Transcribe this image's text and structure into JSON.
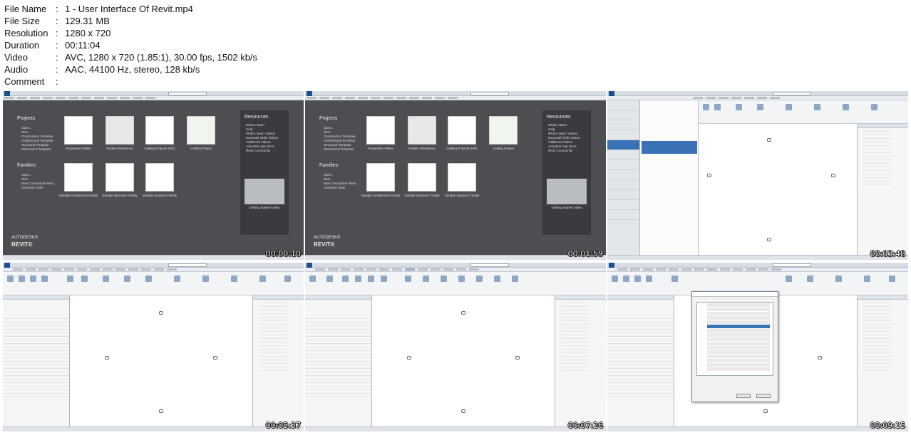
{
  "meta": [
    {
      "key": "File Name",
      "value": "1 - User Interface Of Revit.mp4"
    },
    {
      "key": "File Size",
      "value": "129.31 MB"
    },
    {
      "key": "Resolution",
      "value": "1280 x 720"
    },
    {
      "key": "Duration",
      "value": "00:11:04"
    },
    {
      "key": "Video",
      "value": "AVC, 1280 x 720 (1.85:1), 30.00 fps, 1502 kb/s"
    },
    {
      "key": "Audio",
      "value": "AAC, 44100 Hz, stereo, 128 kb/s"
    },
    {
      "key": "Comment",
      "value": ""
    }
  ],
  "separator": ":",
  "thumbnails": [
    {
      "timestamp": "00:00:10",
      "view": "start-screen"
    },
    {
      "timestamp": "00:01:59",
      "view": "start-screen"
    },
    {
      "timestamp": "00:03:48",
      "view": "file-menu"
    },
    {
      "timestamp": "00:05:37",
      "view": "project"
    },
    {
      "timestamp": "00:07:26",
      "view": "project"
    },
    {
      "timestamp": "00:09:15",
      "view": "customize-dialog"
    }
  ],
  "start_screen": {
    "projects_heading": "Projects",
    "project_links": [
      "Open...",
      "New...",
      "Construction Template",
      "Architectural Template",
      "Structural Template",
      "Mechanical Template"
    ],
    "families_heading": "Families",
    "family_links": [
      "Open...",
      "New...",
      "New Conceptual Mass...",
      "Autodesk Seek"
    ],
    "project_cards": [
      "Properties Pallets",
      "Nodern Residence",
      "Ceilling Projects 0001",
      "Ceilling Project"
    ],
    "family_cards": [
      "Sample Architecture Family",
      "Sample Structure Family",
      "Sample Systems Family"
    ],
    "resources_heading": "Resources",
    "resource_links": [
      "What's New?",
      "Help",
      "What's New? Videos",
      "Essential Skills Videos",
      "Additional Videos",
      "Autodesk App Store",
      "Revit Community"
    ],
    "video_label": "Getting Started Video",
    "brand_top": "AUTODESK®",
    "brand_bottom": "REVIT®"
  },
  "colors": {
    "start_bg": "#4d4e51",
    "resources_bg": "#3a3b3e",
    "selection": "#3b72b6",
    "revit_blue": "#1d4f8f"
  }
}
